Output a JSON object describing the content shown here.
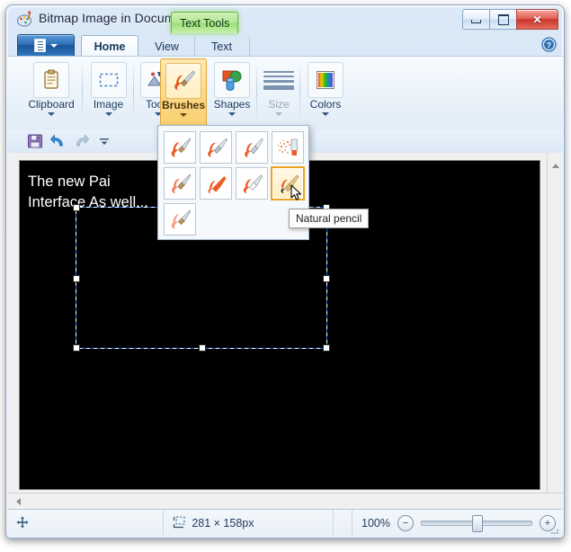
{
  "window": {
    "title": "Bitmap Image in Docume...",
    "app_icon": "paint-palette-icon",
    "contextual_tab": "Text Tools",
    "buttons": {
      "minimize": "minimize-button",
      "maximize": "maximize-button",
      "close": "✕"
    }
  },
  "tabs": {
    "app_menu": "application-menu-button",
    "items": [
      {
        "label": "Home",
        "active": true
      },
      {
        "label": "View",
        "active": false
      },
      {
        "label": "Text",
        "active": false
      }
    ],
    "help": "help-icon"
  },
  "ribbon": {
    "groups": [
      {
        "label": "Clipboard",
        "icon": "clipboard-icon",
        "active": false,
        "disabled": false
      },
      {
        "label": "Image",
        "icon": "selection-icon",
        "active": false,
        "disabled": false
      },
      {
        "label": "Tools",
        "icon": "tools-icon",
        "active": false,
        "disabled": false
      },
      {
        "label": "Brushes",
        "icon": "brush-icon",
        "active": true,
        "disabled": false
      },
      {
        "label": "Shapes",
        "icon": "shapes-icon",
        "active": false,
        "disabled": false
      },
      {
        "label": "Size",
        "icon": "size-lines-icon",
        "active": false,
        "disabled": true
      },
      {
        "label": "Colors",
        "icon": "color-palette-icon",
        "active": false,
        "disabled": false
      }
    ]
  },
  "quick_access": {
    "items": [
      {
        "name": "save-icon",
        "label": "Save"
      },
      {
        "name": "undo-icon",
        "label": "Undo"
      },
      {
        "name": "redo-icon",
        "label": "Redo"
      },
      {
        "name": "customize-quick-access-icon",
        "label": "Customize Quick Access Toolbar"
      }
    ]
  },
  "brushes_flyout": {
    "items": [
      {
        "name": "brush",
        "selected": false
      },
      {
        "name": "calligraphy-brush-1",
        "selected": false
      },
      {
        "name": "calligraphy-brush-2",
        "selected": false
      },
      {
        "name": "airbrush",
        "selected": false
      },
      {
        "name": "oil-brush",
        "selected": false
      },
      {
        "name": "crayon",
        "selected": false
      },
      {
        "name": "marker",
        "selected": false
      },
      {
        "name": "natural-pencil",
        "selected": true
      },
      {
        "name": "watercolour-brush",
        "selected": false
      }
    ],
    "tooltip": "Natural pencil"
  },
  "canvas": {
    "text_line1": "The new Pai",
    "text_line2": "Interface As well...",
    "background_color": "#000000",
    "text_color": "#ffffff"
  },
  "status_bar": {
    "position_icon": "move-cursor-icon",
    "size_icon": "image-size-icon",
    "size_text": "281 × 158px",
    "zoom_level": "100%",
    "zoom_out": "−",
    "zoom_in": "+"
  },
  "colors": {
    "accent": "#e8a421",
    "contextual_tab": "#9adf78",
    "title_blue": "#cfe0f2",
    "canvas": "#000000"
  }
}
